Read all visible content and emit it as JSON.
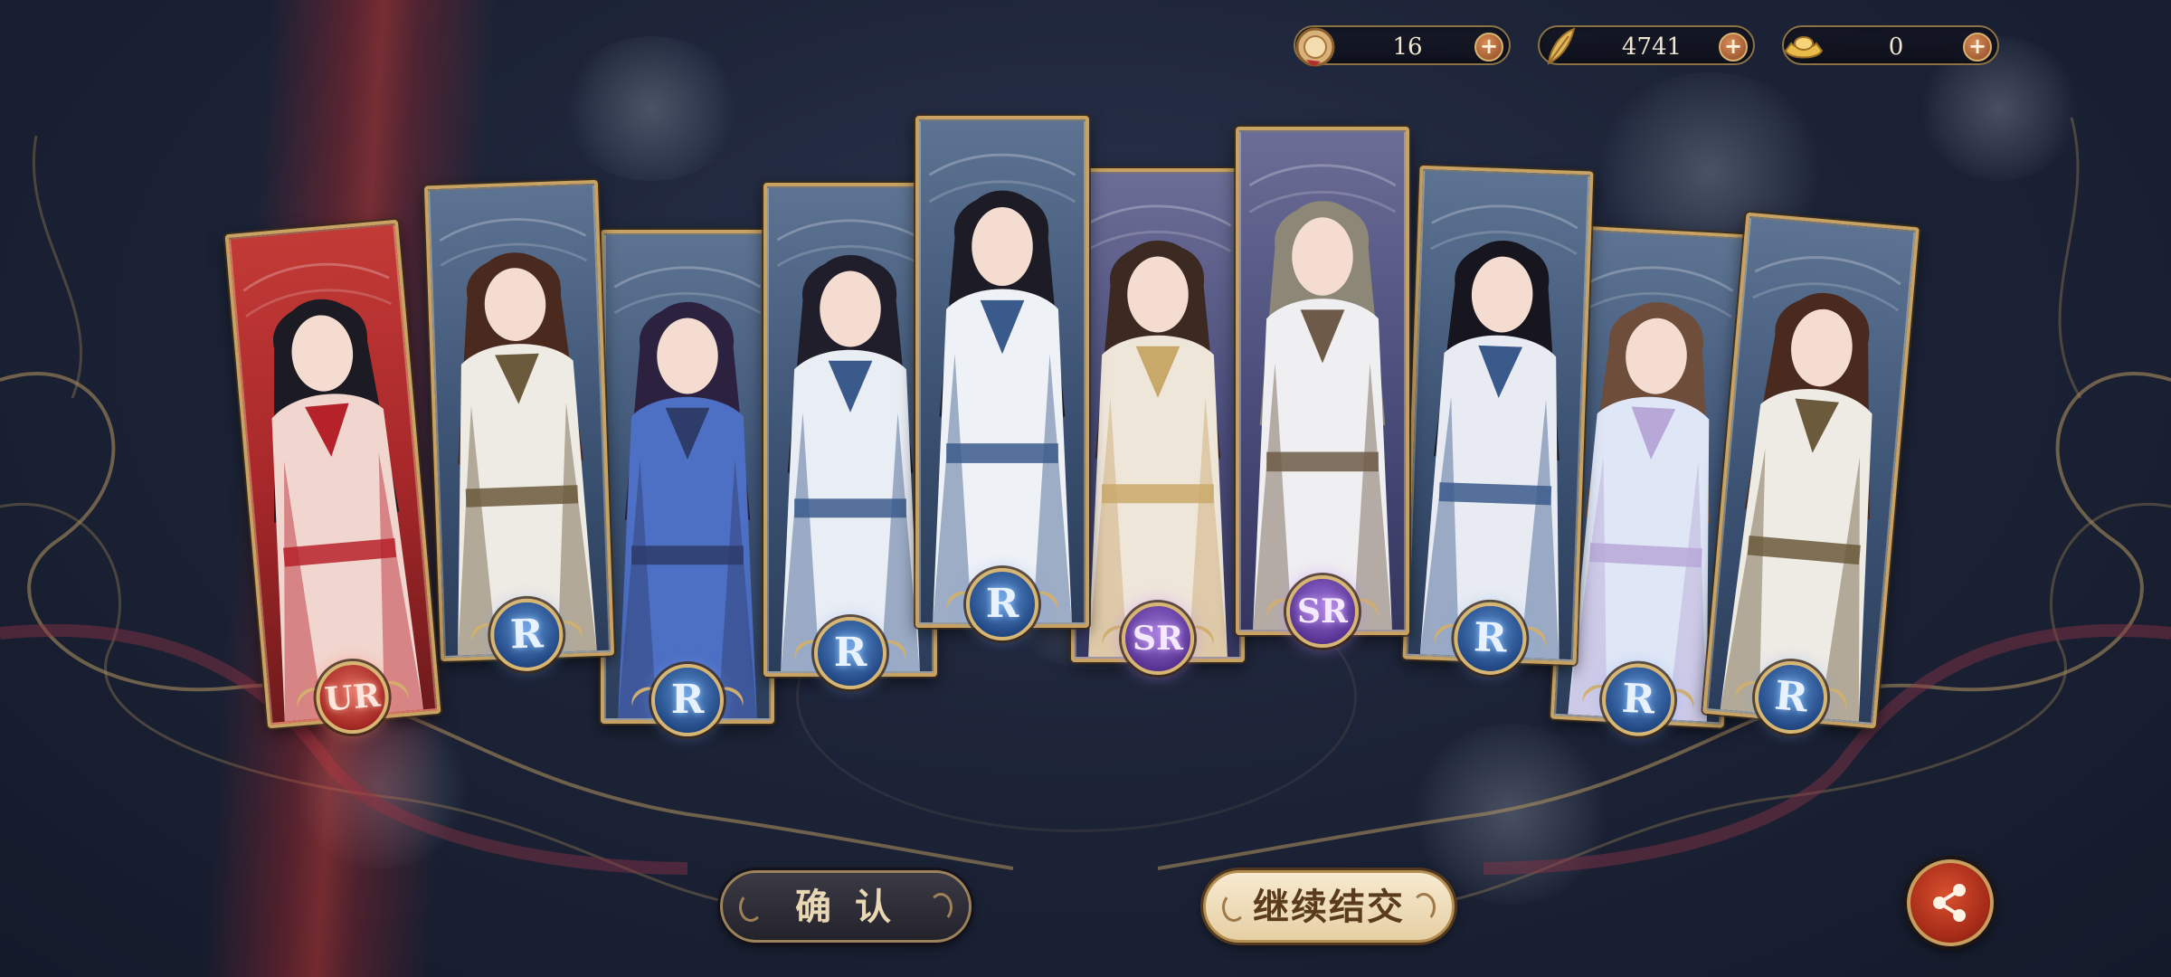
{
  "currencies": [
    {
      "id": "token",
      "icon": "gold-coin-token-icon",
      "value": "16",
      "plus": "+"
    },
    {
      "id": "feather",
      "icon": "golden-feather-icon",
      "value": "4741",
      "plus": "+"
    },
    {
      "id": "ingot",
      "icon": "gold-ingot-icon",
      "value": "0",
      "plus": "+"
    }
  ],
  "cards": [
    {
      "rarity": "UR",
      "theme": "ur"
    },
    {
      "rarity": "R",
      "theme": "r"
    },
    {
      "rarity": "R",
      "theme": "r"
    },
    {
      "rarity": "R",
      "theme": "r"
    },
    {
      "rarity": "R",
      "theme": "r"
    },
    {
      "rarity": "SR",
      "theme": "sr"
    },
    {
      "rarity": "SR",
      "theme": "sr"
    },
    {
      "rarity": "R",
      "theme": "r"
    },
    {
      "rarity": "R",
      "theme": "r"
    },
    {
      "rarity": "R",
      "theme": "r"
    }
  ],
  "buttons": {
    "confirm": "确 认",
    "continue": "继续结交"
  },
  "colors": {
    "card_border": "#c7a262",
    "r_badge": "#234a86",
    "sr_badge": "#5a3596",
    "ur_badge": "#a62a25",
    "share_button": "#a52b18"
  }
}
